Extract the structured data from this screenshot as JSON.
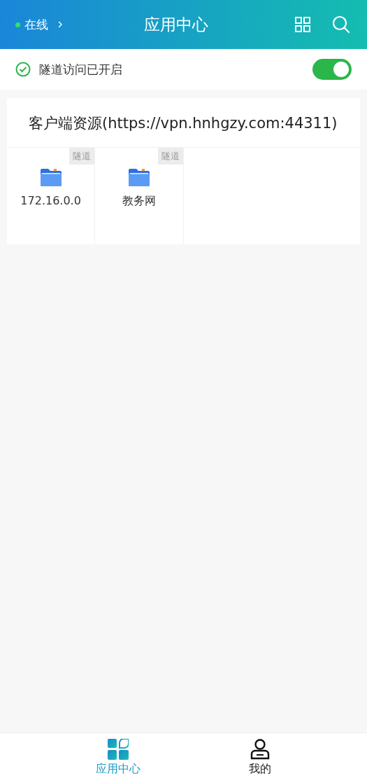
{
  "header": {
    "status": {
      "label": "在线",
      "online": true
    },
    "title": "应用中心"
  },
  "tunnel": {
    "label": "隧道访问已开启",
    "on": true
  },
  "section": {
    "title": "客户端资源(https://vpn.hnhgzy.com:44311)",
    "apps": [
      {
        "label": "172.16.0.0",
        "tag": "隧道"
      },
      {
        "label": "教务网",
        "tag": "隧道"
      }
    ]
  },
  "tabs": [
    {
      "label": "应用中心",
      "kind": "apps",
      "selected": true
    },
    {
      "label": "我的",
      "kind": "profile",
      "selected": false
    }
  ]
}
